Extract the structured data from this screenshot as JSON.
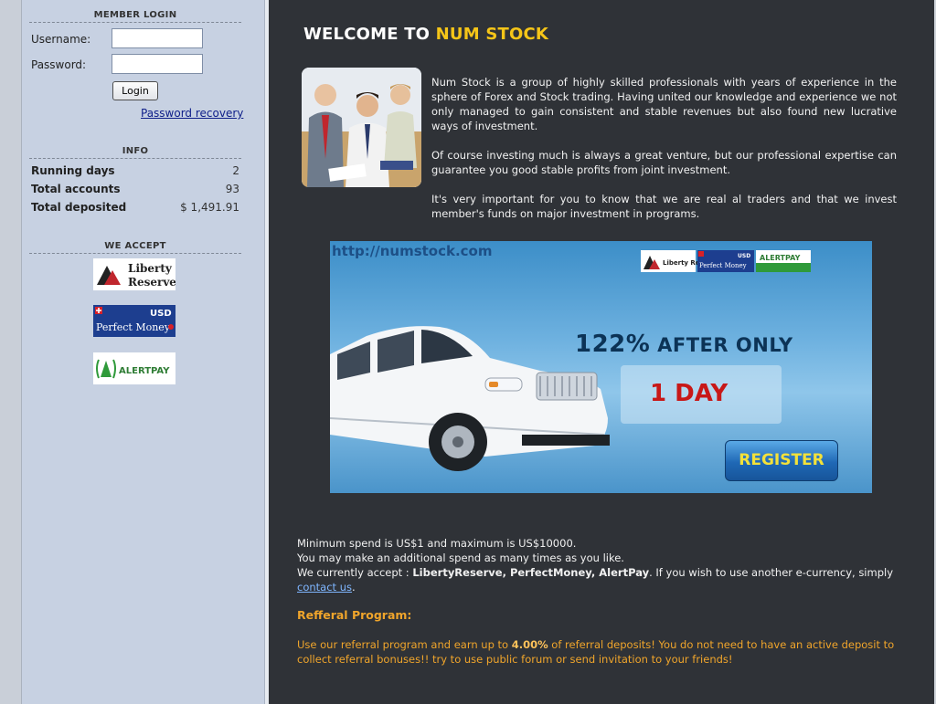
{
  "login": {
    "title": "MEMBER LOGIN",
    "username_label": "Username:",
    "password_label": "Password:",
    "username_value": "",
    "password_value": "",
    "login_button": "Login",
    "recovery_link": "Password recovery"
  },
  "info": {
    "title": "INFO",
    "rows": [
      {
        "label": "Running days",
        "value": "2"
      },
      {
        "label": "Total accounts",
        "value": "93"
      },
      {
        "label": "Total deposited",
        "value": "$ 1,491.91"
      }
    ]
  },
  "accept": {
    "title": "WE ACCEPT",
    "logos": [
      {
        "name": "liberty-reserve",
        "line1": "Liberty",
        "line2": "Reserve"
      },
      {
        "name": "perfect-money",
        "top": "USD",
        "text": "Perfect Money"
      },
      {
        "name": "alertpay",
        "text": "ALERTPAY"
      }
    ]
  },
  "main": {
    "welcome_prefix": "WELCOME TO ",
    "welcome_brand": "NUM STOCK",
    "intro": [
      "Num Stock is a group of highly skilled professionals with years of experience in the sphere of Forex and Stock trading. Having united our knowledge and experience we not only managed to gain consistent and stable revenues but also found new lucrative ways of investment.",
      "Of course investing much is always a great venture, but our professional expertise can guarantee you good stable profits from joint investment.",
      "It's very important for you to know that we are real al traders and that we invest member's funds on major investment in programs."
    ],
    "banner": {
      "url": "http://numstock.com",
      "headline_pct": "122%",
      "headline_rest": " AFTER ONLY",
      "duration": "1 DAY",
      "register": "REGISTER",
      "logo_lr": "Liberty Reserve",
      "logo_pm": "Perfect Money",
      "logo_pm_usd": "USD",
      "logo_ap": "ALERTPAY"
    },
    "details": {
      "line1": "Minimum spend is US$1 and maximum is US$10000.",
      "line2": "You may make an additional spend as many times as you like.",
      "line3_prefix": "We currently accept : ",
      "line3_bold": "LibertyReserve, PerfectMoney, AlertPay",
      "line3_suffix": ". If you wish to use another e-currency, simply ",
      "contact_link": "contact us",
      "period": "."
    },
    "referral": {
      "title": "Refferal Program:",
      "text_prefix": "Use our referral program and earn up to ",
      "percent": "4.00%",
      "text_suffix": " of referral deposits! You do not need to have an active deposit to collect referral bonuses!! try to use public forum or send invitation to your friends!"
    }
  },
  "colors": {
    "sidebar_bg": "#c7d1e2",
    "main_bg": "#2f3237",
    "brand_yellow": "#f5c518",
    "referral_orange": "#f0a52b",
    "link_blue": "#10208a"
  }
}
